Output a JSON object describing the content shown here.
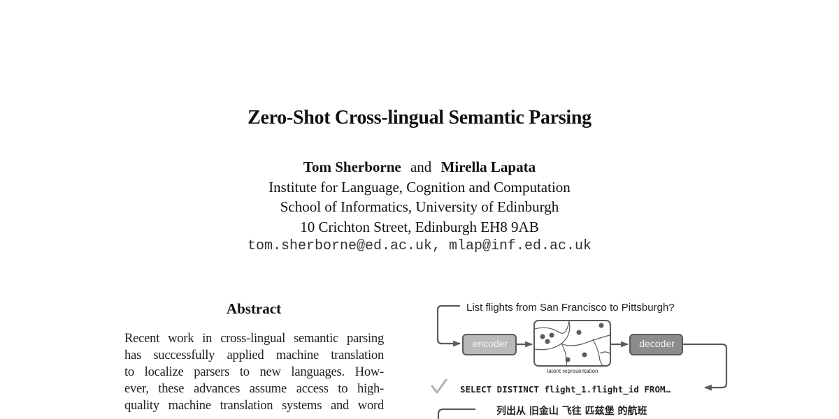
{
  "paper": {
    "title": "Zero-Shot Cross-lingual Semantic Parsing",
    "authors": [
      "Tom Sherborne",
      "Mirella Lapata"
    ],
    "author_conjunction": "and",
    "affiliation_lines": [
      "Institute for Language, Cognition and Computation",
      "School of Informatics, University of Edinburgh",
      "10 Crichton Street, Edinburgh EH8 9AB"
    ],
    "emails": "tom.sherborne@ed.ac.uk, mlap@inf.ed.ac.uk"
  },
  "abstract": {
    "heading": "Abstract",
    "lines": [
      "Recent work in cross-lingual semantic parsing",
      "has successfully applied machine translation",
      "to localize parsers to new languages.  How-",
      "ever, these advances assume access to high-",
      "quality machine translation systems and word"
    ]
  },
  "figure": {
    "question_en": "List flights from San Francisco to Pittsburgh?",
    "encoder_label": "encoder",
    "decoder_label": "decoder",
    "latent_caption": "latent representation",
    "sql_output": "SELECT DISTINCT flight_1.flight_id FROM…",
    "question_zh": "列出从 旧金山 飞往 匹兹堡 的航班",
    "colors": {
      "encoder_fill": "#b9b9b9",
      "decoder_fill": "#8c8c8c",
      "stroke": "#5a5a5a",
      "check": "#b0b0b0"
    }
  }
}
